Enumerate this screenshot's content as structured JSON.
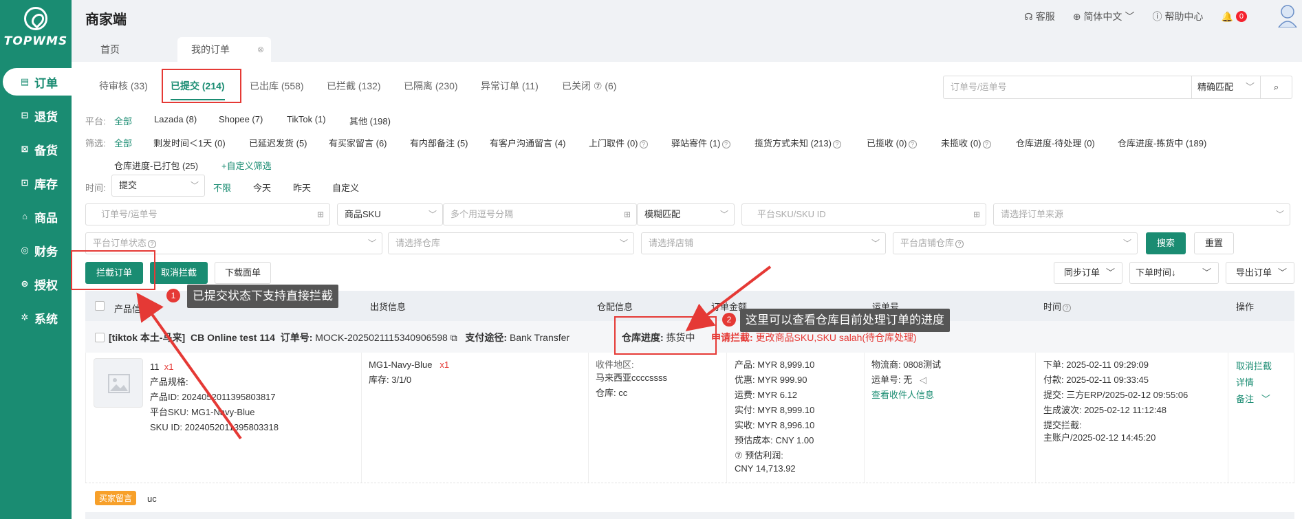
{
  "app": {
    "logo_text": "TOPWMS",
    "title": "商家端"
  },
  "sidebar": {
    "items": [
      {
        "label": "订单",
        "icon": "order-icon",
        "active": true
      },
      {
        "label": "退货",
        "icon": "return-icon"
      },
      {
        "label": "备货",
        "icon": "stock-icon"
      },
      {
        "label": "库存",
        "icon": "inventory-icon"
      },
      {
        "label": "商品",
        "icon": "product-icon"
      },
      {
        "label": "财务",
        "icon": "finance-icon"
      },
      {
        "label": "授权",
        "icon": "auth-icon"
      },
      {
        "label": "系统",
        "icon": "system-icon"
      }
    ]
  },
  "header": {
    "service": "客服",
    "language": "简体中文",
    "help": "帮助中心",
    "notification_count": "0"
  },
  "page_tabs": [
    {
      "label": "首页"
    },
    {
      "label": "我的订单"
    }
  ],
  "status_tabs": [
    {
      "label": "待审核 (33)"
    },
    {
      "label": "已提交 (214)"
    },
    {
      "label": "已出库 (558)"
    },
    {
      "label": "已拦截 (132)"
    },
    {
      "label": "已隔离 (230)"
    },
    {
      "label": "异常订单 (11)"
    },
    {
      "label": "已关闭 ⑦ (6)"
    }
  ],
  "search": {
    "placeholder": "订单号/运单号",
    "mode": "精确匹配"
  },
  "platform": {
    "label": "平台:",
    "options": [
      "全部",
      "Lazada (8)",
      "Shopee (7)",
      "TikTok (1)",
      "其他 (198)"
    ]
  },
  "filter": {
    "label": "筛选:",
    "options": [
      "全部",
      "剩发时间＜1天 (0)",
      "已延迟发货 (5)",
      "有买家留言 (6)",
      "有内部备注 (5)",
      "有客户沟通留言 (4)",
      "上门取件 (0)",
      "驿站寄件 (1)",
      "揽货方式未知 (213)",
      "已揽收 (0)",
      "未揽收 (0)",
      "仓库进度-待处理 (0)",
      "仓库进度-拣货中 (189)",
      "仓库进度-已打包 (25)"
    ],
    "custom": "+自定义筛选"
  },
  "time": {
    "label": "时间:",
    "type": "提交",
    "options": [
      "不限",
      "今天",
      "昨天",
      "自定义"
    ]
  },
  "form": {
    "order_no": "订单号/运单号",
    "sku_type": "商品SKU",
    "multi_sku": "多个用逗号分隔",
    "match": "模糊匹配",
    "platform_sku": "平台SKU/SKU ID",
    "source": "请选择订单来源",
    "platform_status": "平台订单状态",
    "warehouse": "请选择仓库",
    "store": "请选择店铺",
    "platform_warehouse": "平台店铺仓库",
    "search_btn": "搜索",
    "reset_btn": "重置"
  },
  "actions": {
    "intercept": "拦截订单",
    "cancel_intercept": "取消拦截",
    "download": "下载面单",
    "sync": "同步订单",
    "sort": "下单时间↓",
    "export": "导出订单"
  },
  "table": {
    "headers": [
      "产品信息",
      "出货信息",
      "仓配信息",
      "订单金额",
      "运单号",
      "时间",
      "操作"
    ]
  },
  "order": {
    "store": "[tiktok 本土-马来]",
    "shop": "CB Online test 114",
    "order_label": "订单号:",
    "order_no": "MOCK-2025021115340906598",
    "pay_label": "支付途径:",
    "pay": "Bank Transfer",
    "progress_label": "仓库进度:",
    "progress": "拣货中",
    "intercept_label": "申请拦截:",
    "intercept": "更改商品SKU,SKU salah(待仓库处理)",
    "product": {
      "qty_name": "11",
      "qty": "x1",
      "spec": "产品规格:",
      "pid": "产品ID:  2024052011395803817",
      "psku": "平台SKU:  MG1-Navy-Blue",
      "skuid": "SKU ID:  2024052011395803318"
    },
    "shipment": {
      "sku": "MG1-Navy-Blue",
      "qty": "x1",
      "stock": "库存:  3/1/0"
    },
    "warehouse": {
      "region_label": "收件地区:",
      "region": "马来西亚ccccssss",
      "wh": "仓库:  cc"
    },
    "amount": [
      "产品:  MYR 8,999.10",
      "优惠:  MYR 999.90",
      "运费:  MYR 6.12",
      "实付:  MYR 8,999.10",
      "实收:  MYR 8,996.10",
      "预估成本:  CNY 1.00",
      "⑦ 预估利润:",
      "CNY 14,713.92"
    ],
    "shipping": {
      "carrier": "物流商:  0808测试",
      "tracking": "运单号:  无",
      "view": "查看收件人信息"
    },
    "times": [
      "下单:  2025-02-11 09:29:09",
      "付款:  2025-02-11 09:33:45",
      "提交:  三方ERP/2025-02-12 09:55:06",
      "生成波次:  2025-02-12 11:12:48",
      "提交拦截:",
      "主账户/2025-02-12 14:45:20"
    ],
    "ops": [
      "取消拦截",
      "详情",
      "备注"
    ],
    "note_tag": "买家留言",
    "note": "uc"
  },
  "annotations": [
    {
      "num": "1",
      "text": "已提交状态下支持直接拦截"
    },
    {
      "num": "2",
      "text": "这里可以查看仓库目前处理订单的进度"
    }
  ]
}
